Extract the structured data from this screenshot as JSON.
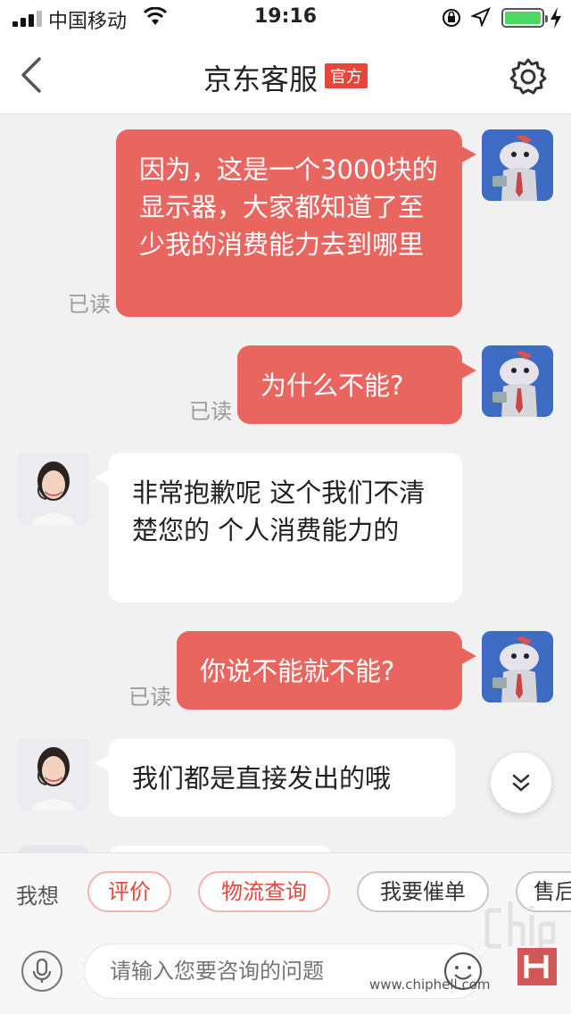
{
  "status_bar": {
    "carrier": "中国移动",
    "time": "19:16"
  },
  "nav": {
    "title": "京东客服",
    "badge": "官方",
    "icons": [
      "back-chevron-icon",
      "gear-icon"
    ]
  },
  "messages": [
    {
      "side": "out",
      "text": "因为，这是一个3000块的显示器，大家都知道了至少我的消费能力去到哪里",
      "read": "已读"
    },
    {
      "side": "out",
      "text": "为什么不能?",
      "read": "已读"
    },
    {
      "side": "in",
      "text": "非常抱歉呢  这个我们不清楚您的 个人消费能力的"
    },
    {
      "side": "out",
      "text": "你说不能就不能?",
      "read": "已读"
    },
    {
      "side": "in",
      "text": "我们都是直接发出的哦"
    }
  ],
  "quick_replies": {
    "label": "我想",
    "chips": [
      "评价",
      "物流查询",
      "我要催单",
      "售后"
    ]
  },
  "input": {
    "placeholder": "请输入您要咨询的问题"
  },
  "watermark": {
    "text": "www.chiphell.com"
  },
  "colors": {
    "outgoing_bubble": "#e8665f",
    "badge": "#e8463c",
    "battery": "#4cd964"
  }
}
